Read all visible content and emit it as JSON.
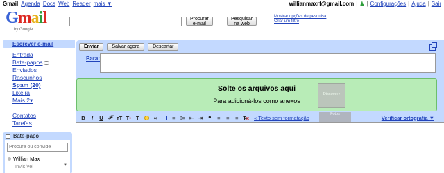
{
  "topbar": {
    "links": [
      "Gmail",
      "Agenda",
      "Docs",
      "Web",
      "Reader",
      "mais ▼"
    ],
    "email": "willianmaxrf@gmail.com",
    "right_links": [
      "Configurações",
      "Ajuda",
      "Sair"
    ]
  },
  "logo": {
    "letters": [
      "G",
      "m",
      "a",
      "i",
      "l"
    ],
    "by": "by Google"
  },
  "search": {
    "value": "",
    "search_mail": "Procurar e-mail",
    "search_web": "Pesquisar na web",
    "show_options": "Mostrar opções de pesquisa",
    "create_filter": "Criar um filtro"
  },
  "sidebar": {
    "compose": "Escrever e-mail",
    "items": [
      "Entrada",
      "Bate-papos",
      "Enviados",
      "Rascunhos",
      "Spam (20)",
      "Lixeira",
      "Mais 2▾"
    ],
    "items2": [
      "Contatos",
      "Tarefas"
    ],
    "chat": {
      "title": "Bate-papo",
      "placeholder": "Procure ou convide",
      "user": "Willian Max",
      "status": "Invisível"
    }
  },
  "compose": {
    "send": "Enviar",
    "save": "Salvar agora",
    "discard": "Descartar",
    "to_label": "Para:",
    "drop_title": "Solte os arquivos aqui",
    "drop_sub": "Para adicioná-los como anexos",
    "plain_text": "« Texto sem formatação",
    "spellcheck": "Verificar ortografia ▼",
    "ghost_label": "Discovery",
    "ghost2_label": "Fotos"
  },
  "colors": {
    "accent": "#c3d9ff",
    "link": "#2244bb",
    "dropzone": "#b8ecb7"
  }
}
